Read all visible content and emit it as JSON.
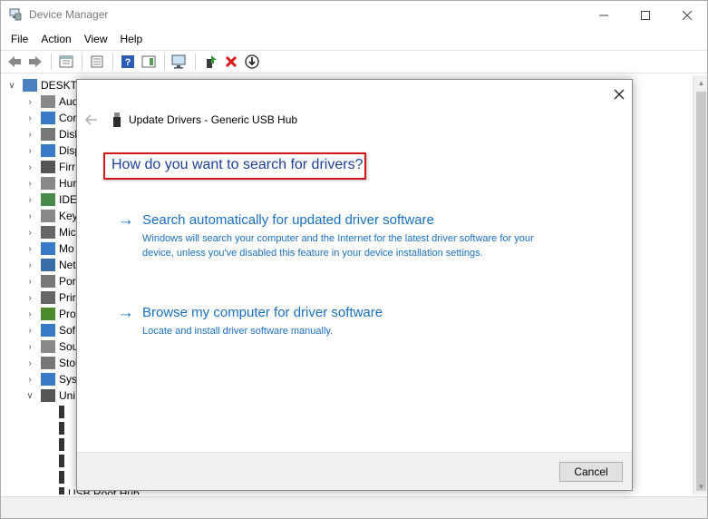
{
  "window": {
    "title": "Device Manager"
  },
  "menu": [
    "File",
    "Action",
    "View",
    "Help"
  ],
  "tree": {
    "root": "DESKTO",
    "categories": [
      "Aud",
      "Cor",
      "Disl",
      "Disp",
      "Firr",
      "Hur",
      "IDE",
      "Key",
      "Mic",
      "Mo",
      "Net",
      "Por",
      "Prir",
      "Pro",
      "Sof",
      "Sou",
      "Stol",
      "Sys",
      "Uni"
    ],
    "last_visible": "USB Root Hub"
  },
  "dialog": {
    "title": "Update Drivers - Generic USB Hub",
    "question": "How do you want to search for drivers?",
    "option1": {
      "title": "Search automatically for updated driver software",
      "description": "Windows will search your computer and the Internet for the latest driver software for your device, unless you've disabled this feature in your device installation settings."
    },
    "option2": {
      "title": "Browse my computer for driver software",
      "description": "Locate and install driver software manually."
    },
    "cancel_label": "Cancel"
  },
  "colors": {
    "link": "#1a6fc2",
    "heading": "#1e3f9a",
    "highlight_border": "#d0181c"
  }
}
